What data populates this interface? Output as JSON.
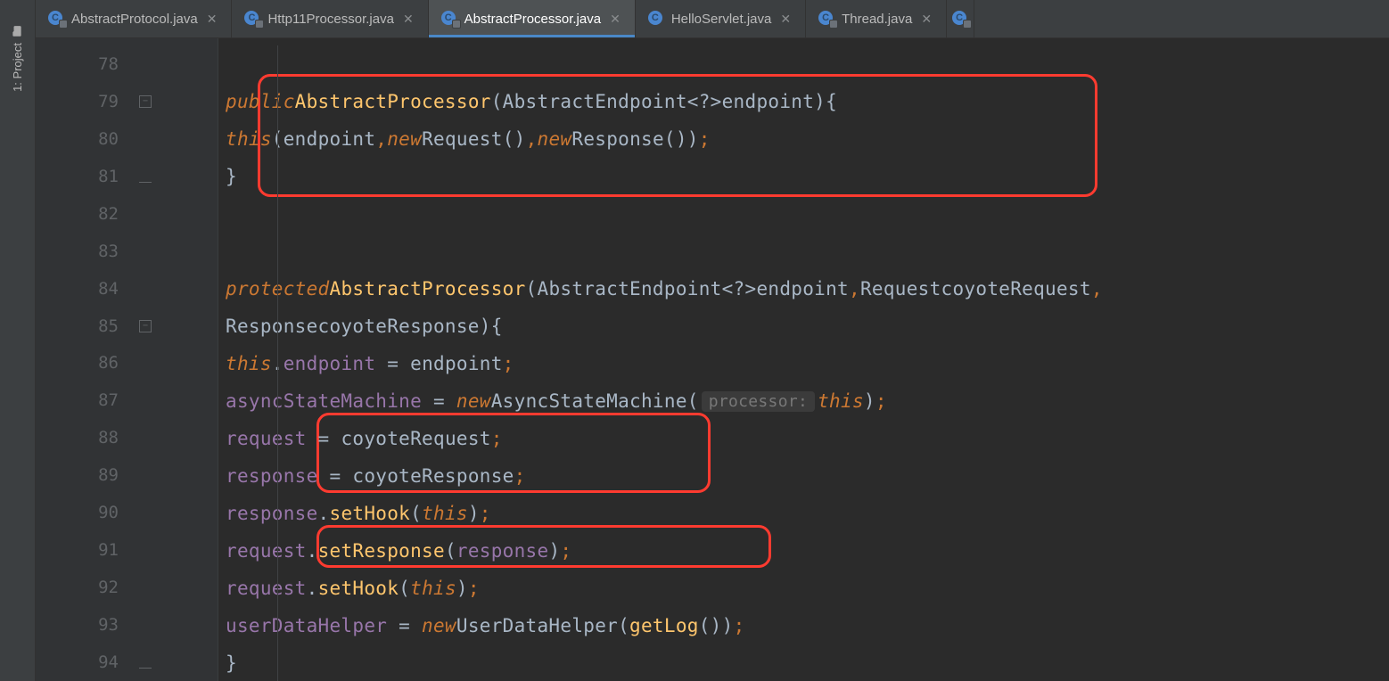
{
  "sidebar": {
    "project_label": "1: Project"
  },
  "tabs": [
    {
      "label": "AbstractProtocol.java",
      "active": false,
      "locked": true
    },
    {
      "label": "Http11Processor.java",
      "active": false,
      "locked": true
    },
    {
      "label": "AbstractProcessor.java",
      "active": true,
      "locked": true
    },
    {
      "label": "HelloServlet.java",
      "active": false,
      "locked": false
    },
    {
      "label": "Thread.java",
      "active": false,
      "locked": true
    }
  ],
  "code": {
    "line_numbers": [
      "78",
      "79",
      "80",
      "81",
      "82",
      "83",
      "84",
      "85",
      "86",
      "87",
      "88",
      "89",
      "90",
      "91",
      "92",
      "93",
      "94"
    ],
    "lines": {
      "l79": {
        "kw": "public",
        "ctor": "AbstractProcessor",
        "params_type": "AbstractEndpoint",
        "generic": "<?>",
        "param_name": "endpoint",
        "brace": "{"
      },
      "l80": {
        "kw_this": "this",
        "arg1": "endpoint",
        "kw_new1": "new",
        "type1": "Request",
        "kw_new2": "new",
        "type2": "Response",
        "semi": ";"
      },
      "l81": {
        "brace": "}"
      },
      "l84": {
        "kw": "protected",
        "ctor": "AbstractProcessor",
        "type1": "AbstractEndpoint",
        "generic": "<?>",
        "p1": "endpoint",
        "type2": "Request",
        "p2": "coyoteRequest",
        "comma": ","
      },
      "l85": {
        "type": "Response",
        "p": "coyoteResponse",
        "brace": "{"
      },
      "l86": {
        "kw_this": "this",
        "field": "endpoint",
        "rhs": "endpoint",
        "semi": ";"
      },
      "l87": {
        "field": "asyncStateMachine",
        "kw_new": "new",
        "type": "AsyncStateMachine",
        "hint": "processor:",
        "kw_this": "this",
        "semi": ";"
      },
      "l88": {
        "field": "request",
        "rhs": "coyoteRequest",
        "semi": ";"
      },
      "l89": {
        "field": "response",
        "rhs": "coyoteResponse",
        "semi": ";"
      },
      "l90": {
        "obj": "response",
        "method": "setHook",
        "kw_this": "this",
        "semi": ";"
      },
      "l91": {
        "obj": "request",
        "method": "setResponse",
        "arg": "response",
        "semi": ";"
      },
      "l92": {
        "obj": "request",
        "method": "setHook",
        "kw_this": "this",
        "semi": ";"
      },
      "l93": {
        "field": "userDataHelper",
        "kw_new": "new",
        "type": "UserDataHelper",
        "call": "getLog",
        "semi": ";"
      },
      "l94": {
        "brace": "}"
      }
    }
  }
}
